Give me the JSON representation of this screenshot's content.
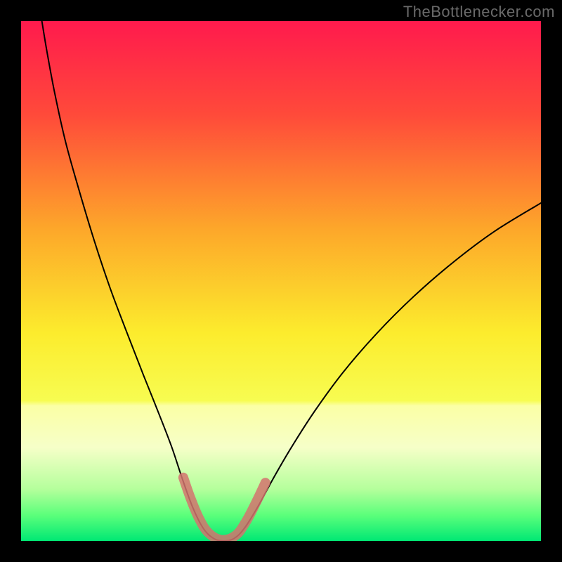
{
  "watermark": "TheBottlenecker.com",
  "chart_data": {
    "type": "line",
    "title": "",
    "xlabel": "",
    "ylabel": "",
    "xlim": [
      0,
      100
    ],
    "ylim": [
      0,
      100
    ],
    "background_gradient_stops": [
      {
        "offset": 0.0,
        "color": "#ff1a4d"
      },
      {
        "offset": 0.18,
        "color": "#ff4a3a"
      },
      {
        "offset": 0.4,
        "color": "#fda72a"
      },
      {
        "offset": 0.6,
        "color": "#fcec2d"
      },
      {
        "offset": 0.73,
        "color": "#f7fc51"
      },
      {
        "offset": 0.74,
        "color": "#fbffa5"
      },
      {
        "offset": 0.82,
        "color": "#f6ffc8"
      },
      {
        "offset": 0.9,
        "color": "#b5ff9c"
      },
      {
        "offset": 0.95,
        "color": "#5cff7b"
      },
      {
        "offset": 1.0,
        "color": "#00e874"
      }
    ],
    "series": [
      {
        "name": "bottleneck-curve",
        "stroke": "#000000",
        "stroke_width": 2,
        "points": [
          {
            "x": 4.0,
            "y": 100.0
          },
          {
            "x": 5.0,
            "y": 94.0
          },
          {
            "x": 6.5,
            "y": 86.0
          },
          {
            "x": 8.5,
            "y": 77.0
          },
          {
            "x": 11.0,
            "y": 68.0
          },
          {
            "x": 14.0,
            "y": 58.0
          },
          {
            "x": 17.0,
            "y": 49.0
          },
          {
            "x": 20.0,
            "y": 41.0
          },
          {
            "x": 23.5,
            "y": 32.0
          },
          {
            "x": 26.5,
            "y": 24.5
          },
          {
            "x": 29.0,
            "y": 18.0
          },
          {
            "x": 31.0,
            "y": 12.0
          },
          {
            "x": 33.0,
            "y": 6.5
          },
          {
            "x": 35.0,
            "y": 2.5
          },
          {
            "x": 37.0,
            "y": 0.5
          },
          {
            "x": 39.0,
            "y": 0.0
          },
          {
            "x": 41.0,
            "y": 0.5
          },
          {
            "x": 43.0,
            "y": 2.5
          },
          {
            "x": 45.5,
            "y": 6.5
          },
          {
            "x": 48.5,
            "y": 12.0
          },
          {
            "x": 52.0,
            "y": 18.0
          },
          {
            "x": 56.5,
            "y": 25.0
          },
          {
            "x": 62.0,
            "y": 32.5
          },
          {
            "x": 68.5,
            "y": 40.0
          },
          {
            "x": 75.5,
            "y": 47.0
          },
          {
            "x": 83.0,
            "y": 53.5
          },
          {
            "x": 91.0,
            "y": 59.5
          },
          {
            "x": 100.0,
            "y": 65.0
          }
        ]
      },
      {
        "name": "highlight-band",
        "stroke": "#d4736e",
        "stroke_width": 14,
        "opacity": 0.85,
        "cap": "round",
        "points": [
          {
            "x": 31.2,
            "y": 12.2
          },
          {
            "x": 32.6,
            "y": 8.2
          },
          {
            "x": 34.2,
            "y": 4.4
          },
          {
            "x": 36.0,
            "y": 1.6
          },
          {
            "x": 38.5,
            "y": 0.2
          },
          {
            "x": 41.2,
            "y": 1.0
          },
          {
            "x": 43.2,
            "y": 3.6
          },
          {
            "x": 45.2,
            "y": 7.4
          },
          {
            "x": 47.0,
            "y": 11.2
          }
        ]
      }
    ]
  }
}
